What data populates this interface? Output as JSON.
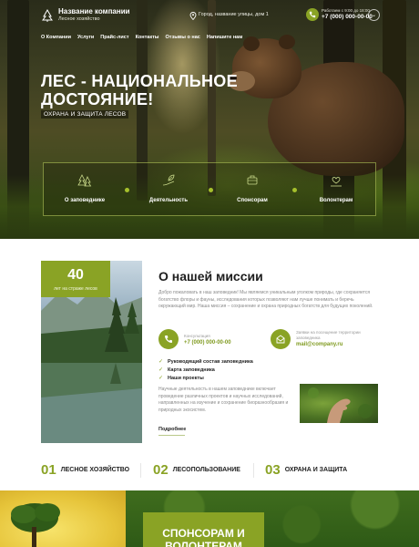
{
  "header": {
    "company_name": "Название компании",
    "company_sub": "Лесное хозяйство",
    "address": "Город, название улицы, дом 1",
    "hours": "Работаем с 9:00 до 18:00",
    "phone": "+7 (000) 000-00-00"
  },
  "nav": {
    "items": [
      "О Компании",
      "Услуги",
      "Прайс-лист",
      "Контакты",
      "Отзывы о нас",
      "Напишите нам"
    ]
  },
  "hero": {
    "title": "ЛЕС - НАЦИОНАЛЬНОЕ ДОСТОЯНИЕ!",
    "subtitle": "ОХРАНА И ЗАЩИТА ЛЕСОВ",
    "features": [
      "О заповеднике",
      "Деятельность",
      "Спонсорам",
      "Волонтерам"
    ]
  },
  "stat": {
    "value": "40",
    "caption": "лет на страже лесов"
  },
  "mission": {
    "title": "О нашей миссии",
    "text": "Добро пожаловать в наш заповедник! Мы являемся уникальным уголком природы, где сохраняется богатство флоры и фауны, исследования которых позволяют нам лучше понимать и беречь окружающий мир. Наша миссия – сохранение и охрана природных богатств для будущих поколений.",
    "consult_caption": "Консультация",
    "consult_phone": "+7 (000) 000-00-00",
    "email_caption": "Заявки на посещение территории заповедника",
    "email": "mail@company.ru",
    "checklist": [
      "Руководящий состав заповедника",
      "Карта заповедника",
      "Наши проекты"
    ],
    "research_text": "Научные деятельность в нашем заповеднике включает проведение различных проектов и научных исследований, направленных на изучение и сохранение биоразнообразия и природных экосистем.",
    "more_label": "Подробнее"
  },
  "numbered": [
    {
      "num": "01",
      "label": "ЛЕСНОЕ ХОЗЯЙСТВО"
    },
    {
      "num": "02",
      "label": "ЛЕСОПОЛЬЗОВАНИЕ"
    },
    {
      "num": "03",
      "label": "ОХРАНА И ЗАЩИТА"
    }
  ],
  "sponsor": {
    "title": "СПОНСОРАМ И ВОЛОНТЕРАМ"
  },
  "colors": {
    "accent": "#8aa325",
    "dark_text": "#1e1e1e",
    "muted_text": "#8a8a8a"
  }
}
